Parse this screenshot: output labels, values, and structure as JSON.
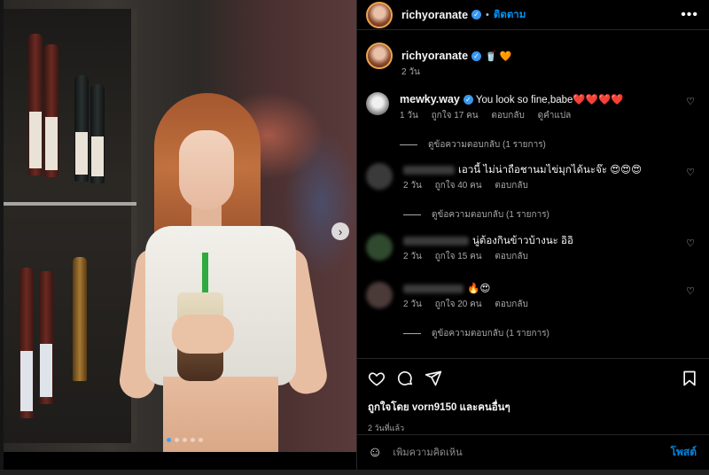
{
  "post": {
    "author": "richyoranate",
    "follow_label": "ติดตาม",
    "separator": "•",
    "more_label": "•••",
    "caption_emoji": "🥤 🧡",
    "caption_time": "2 วัน",
    "photo_dot_count": 5,
    "active_dot": 0
  },
  "comments": [
    {
      "user": "mewky.way",
      "text": "You look so fine,babe❤️❤️❤️❤️",
      "time": "1 วัน",
      "likes": "ถูกใจ 17 คน",
      "reply": "ตอบกลับ",
      "translate": "ดูคำแปล",
      "view_replies": "ดูข้อความตอบกลับ (1 รายการ)"
    },
    {
      "user": "",
      "text": "เอวนี้ ไม่น่าถือชานมไข่มุกได้นะจ๊ะ 😍😍😍",
      "time": "2 วัน",
      "likes": "ถูกใจ 40 คน",
      "reply": "ตอบกลับ",
      "view_replies": "ดูข้อความตอบกลับ (1 รายการ)"
    },
    {
      "user": "",
      "text": "นู่ต้องกินข้าวบ้างนะ อิอิ",
      "time": "2 วัน",
      "likes": "ถูกใจ 15 คน",
      "reply": "ตอบกลับ"
    },
    {
      "user": "",
      "text": "🔥😍",
      "time": "2 วัน",
      "likes": "ถูกใจ 20 คน",
      "reply": "ตอบกลับ",
      "view_replies": "ดูข้อความตอบกลับ (1 รายการ)"
    }
  ],
  "actions": {
    "liked_by": "ถูกใจโดย vorn9150 และคนอื่นๆ",
    "posted_time": "2 วันที่แล้ว"
  },
  "composer": {
    "placeholder": "เพิ่มความคิดเห็น",
    "post_label": "โพสต์",
    "emoji_icon": "☺"
  },
  "icons": {
    "like": "heart-icon",
    "comment": "comment-icon",
    "share": "share-icon",
    "save": "bookmark-icon",
    "next": "›"
  },
  "colors": {
    "accent": "#0095f6",
    "verified": "#3897f0",
    "background": "#000000"
  }
}
